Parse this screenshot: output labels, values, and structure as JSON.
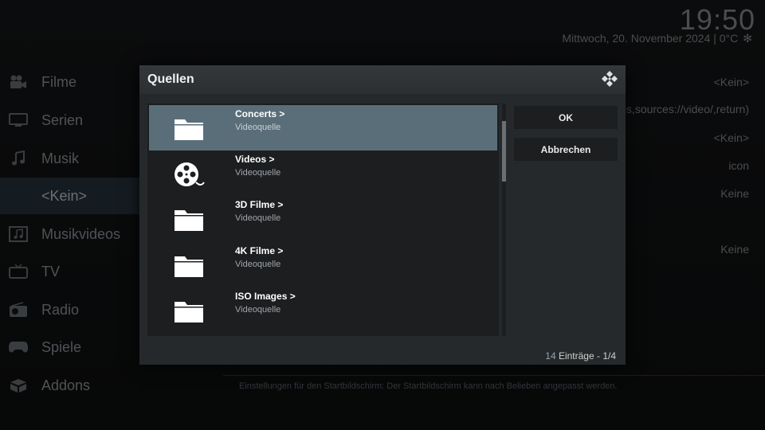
{
  "header": {
    "clock": "19:50",
    "date": "Mittwoch, 20. November 2024 | 0°C",
    "weather_icon": "snowflake-icon"
  },
  "sidebar": {
    "items": [
      {
        "label": "Filme",
        "icon": "movie-camera-icon"
      },
      {
        "label": "Serien",
        "icon": "tv-monitor-icon"
      },
      {
        "label": "Musik",
        "icon": "music-note-icon"
      },
      {
        "label": "<Kein>",
        "icon": ""
      },
      {
        "label": "Musikvideos",
        "icon": "music-video-icon"
      },
      {
        "label": "TV",
        "icon": "tv-icon"
      },
      {
        "label": "Radio",
        "icon": "radio-icon"
      },
      {
        "label": "Spiele",
        "icon": "gamepad-icon"
      },
      {
        "label": "Addons",
        "icon": "addons-box-icon"
      }
    ]
  },
  "right_panel": {
    "values": [
      "<Kein>",
      "os,sources://video/,return)",
      "<Kein>",
      "icon",
      "Keine",
      "Keine"
    ],
    "hint": "Einstellungen für den Startbildschirm: Der Startbildschirm kann nach Belieben angepasst werden."
  },
  "dialog": {
    "title": "Quellen",
    "items": [
      {
        "title": "Concerts  >",
        "subtitle": "Videoquelle",
        "icon": "folder-icon",
        "selected": true
      },
      {
        "title": "Videos  >",
        "subtitle": "Videoquelle",
        "icon": "film-reel-icon",
        "selected": false
      },
      {
        "title": "3D Filme  >",
        "subtitle": "Videoquelle",
        "icon": "folder-icon",
        "selected": false
      },
      {
        "title": "4K Filme  >",
        "subtitle": "Videoquelle",
        "icon": "folder-icon",
        "selected": false
      },
      {
        "title": "ISO Images  >",
        "subtitle": "Videoquelle",
        "icon": "folder-icon",
        "selected": false
      }
    ],
    "ok_label": "OK",
    "cancel_label": "Abbrechen",
    "count_number": "14",
    "count_rest": " Einträge - 1/4"
  },
  "colors": {
    "selection": "#5a6e7a",
    "dialog_bg": "#26292b",
    "list_bg": "#1c1e20"
  }
}
